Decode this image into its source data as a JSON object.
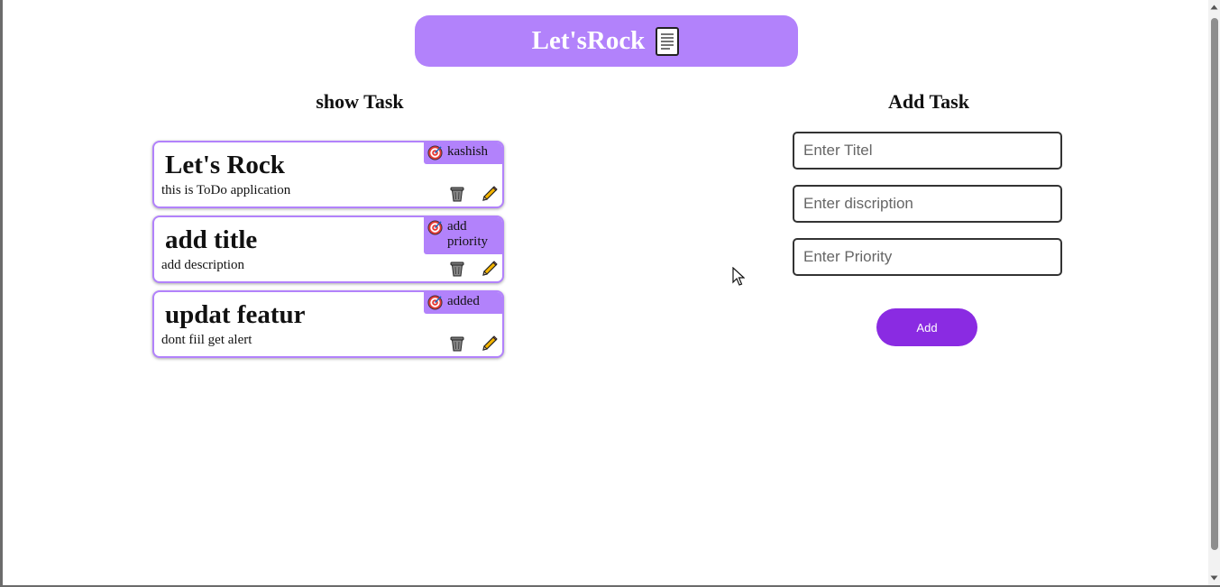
{
  "header": {
    "title": "Let'sRock",
    "icon": "document-icon"
  },
  "show_task": {
    "heading": "show Task",
    "tasks": [
      {
        "title": "Let's Rock",
        "description": "this is ToDo application",
        "priority": "kashish"
      },
      {
        "title": "add title",
        "description": "add description",
        "priority": "add priority"
      },
      {
        "title": "updat featur",
        "description": "dont fiil get alert",
        "priority": "added"
      }
    ]
  },
  "add_task": {
    "heading": "Add Task",
    "title_placeholder": "Enter Titel",
    "description_placeholder": "Enter discription",
    "priority_placeholder": "Enter Priority",
    "add_label": "Add"
  },
  "colors": {
    "accent": "#b282fb",
    "button": "#8a2be2"
  }
}
